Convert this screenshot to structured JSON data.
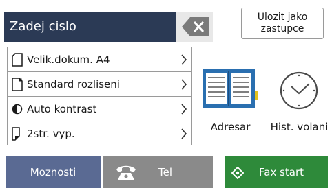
{
  "entry": {
    "title": "Zadej cislo"
  },
  "save_button": {
    "line1": "Ulozit jako",
    "line2": "zastupce"
  },
  "settings": [
    {
      "label": "Velik.dokum. A4",
      "icon": "document-size-icon"
    },
    {
      "label": "Standard rozliseni",
      "icon": "resolution-icon"
    },
    {
      "label": "Auto kontrast",
      "icon": "contrast-icon"
    },
    {
      "label": "2str. vyp.",
      "icon": "duplex-icon"
    }
  ],
  "tiles": {
    "address_book": {
      "label": "Adresar",
      "icon": "address-book-icon"
    },
    "call_history": {
      "label": "Hist. volani",
      "icon": "clock-icon"
    }
  },
  "bottom": {
    "options": "Moznosti",
    "tel": "Tel",
    "fax_start": "Fax start"
  },
  "colors": {
    "entry_bg": "#2b3a55",
    "options_bg": "#5a6a93",
    "tel_bg": "#8a8a8a",
    "fax_bg": "#2e8a3a",
    "book_blue": "#2a6fb0",
    "book_tab": "#e3c21c"
  }
}
